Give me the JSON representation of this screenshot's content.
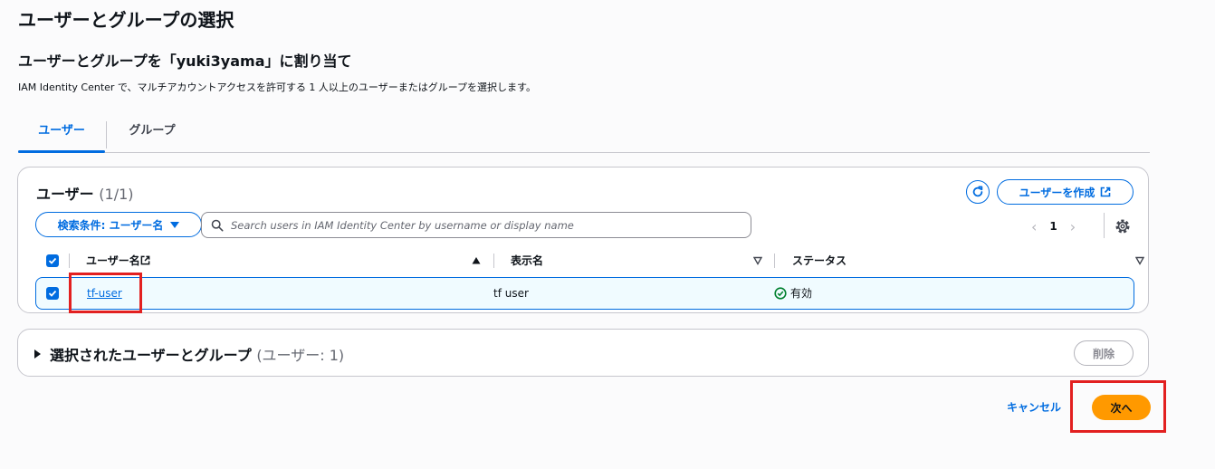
{
  "page": {
    "title": "ユーザーとグループの選択",
    "subtitle": "ユーザーとグループを「yuki3yama」に割り当て",
    "description": "IAM Identity Center で、マルチアカウントアクセスを許可する 1 人以上のユーザーまたはグループを選択します。"
  },
  "tabs": [
    {
      "label": "ユーザー",
      "active": true
    },
    {
      "label": "グループ",
      "active": false
    }
  ],
  "users_panel": {
    "title": "ユーザー",
    "count": "(1/1)",
    "create_button": "ユーザーを作成",
    "filter_button": "検索条件: ユーザー名",
    "search_placeholder": "Search users in IAM Identity Center by username or display name",
    "search_value": "",
    "page_number": "1",
    "columns": [
      "ユーザー名",
      "表示名",
      "ステータス"
    ],
    "rows": [
      {
        "username": "tf-user",
        "display_name": "tf user",
        "status": "有効",
        "selected": true
      }
    ]
  },
  "selected_panel": {
    "title": "選択されたユーザーとグループ",
    "count": "(ユーザー: 1)",
    "remove_button": "削除",
    "expanded": false
  },
  "footer": {
    "cancel": "キャンセル",
    "next": "次へ"
  },
  "icons": [
    "refresh-icon",
    "external-link-icon",
    "caret-down-icon",
    "search-icon",
    "chevron-left-icon",
    "chevron-right-icon",
    "gear-icon",
    "checkbox-checked-icon",
    "sort-ascending-icon",
    "sort-icon",
    "status-success-icon",
    "caret-right-icon"
  ],
  "colors": {
    "accent": "#006ce0",
    "primary_button": "#ff9900",
    "highlight": "#e22020",
    "success": "#00802f",
    "selected_row_bg": "#f0fbff"
  }
}
